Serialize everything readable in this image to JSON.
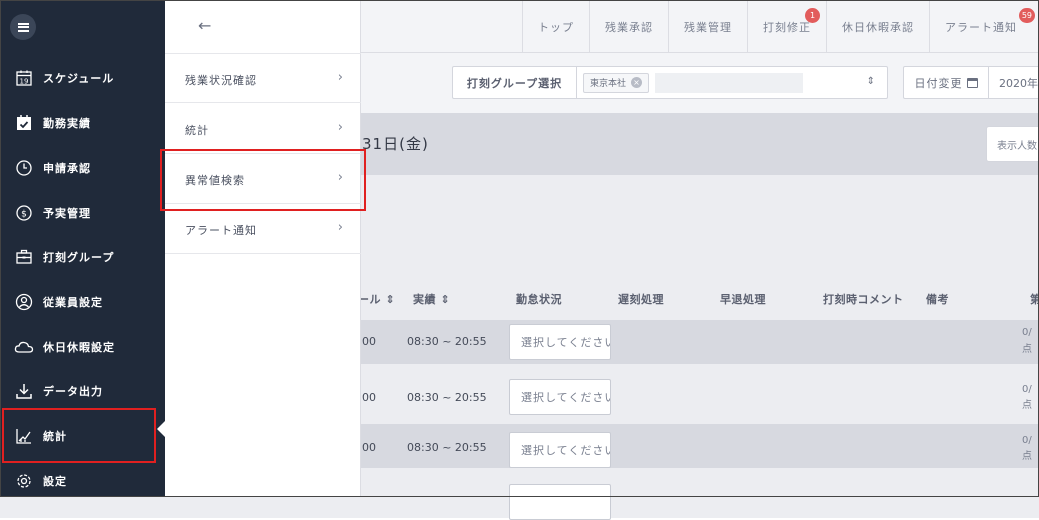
{
  "topnav": [
    {
      "label": "トップ",
      "badge": ""
    },
    {
      "label": "残業承認",
      "badge": ""
    },
    {
      "label": "残業管理",
      "badge": ""
    },
    {
      "label": "打刻修正",
      "badge": "1"
    },
    {
      "label": "休日休暇承認",
      "badge": ""
    },
    {
      "label": "アラート通知",
      "badge": "59"
    }
  ],
  "filter": {
    "group_label": "打刻グループ選択",
    "group_chip": "東京本社",
    "chip_clear_glyph": "×",
    "updown_glyph": "⇕",
    "date_change_label": "日付変更",
    "date_value": "2020年"
  },
  "date_title": "31日(金)",
  "show_count_label": "表示人数",
  "table": {
    "headers": [
      "ール ⇕",
      "実績 ⇕",
      "勤怠状況",
      "遅刻処理",
      "早退処理",
      "打刻時コメント",
      "備考",
      "第"
    ],
    "rows": [
      {
        "sched": "00",
        "actual": "08:30 ~ 20:55",
        "status": "選択してください",
        "edge1": "0/",
        "edge2": "点"
      },
      {
        "sched": "00",
        "actual": "08:30 ~ 20:55",
        "status": "選択してください",
        "edge1": "0/",
        "edge2": "点"
      },
      {
        "sched": "00",
        "actual": "08:30 ~ 20:55",
        "status": "選択してください",
        "edge1": "0/",
        "edge2": "点"
      },
      {
        "sched": "",
        "actual": "",
        "status": "",
        "edge1": "",
        "edge2": ""
      }
    ]
  },
  "sidebar": {
    "items": [
      {
        "label": "スケジュール",
        "icon": "calendar-icon"
      },
      {
        "label": "勤務実績",
        "icon": "calendar-check-icon"
      },
      {
        "label": "申請承認",
        "icon": "clock-icon"
      },
      {
        "label": "予実管理",
        "icon": "dollar-icon"
      },
      {
        "label": "打刻グループ",
        "icon": "briefcase-icon"
      },
      {
        "label": "従業員設定",
        "icon": "user-icon"
      },
      {
        "label": "休日休暇設定",
        "icon": "cloud-icon"
      },
      {
        "label": "データ出力",
        "icon": "download-icon"
      },
      {
        "label": "統計",
        "icon": "chart-icon"
      },
      {
        "label": "設定",
        "icon": "gear-icon"
      }
    ],
    "calendar_day": "19"
  },
  "submenu": {
    "back_glyph": "←",
    "chevron_glyph": "›",
    "items": [
      {
        "label": "残業状況確認"
      },
      {
        "label": "統計"
      },
      {
        "label": "異常値検索"
      },
      {
        "label": "アラート通知"
      }
    ]
  },
  "colors": {
    "sidebar_bg": "#202a3a",
    "highlight": "#e02020",
    "badge": "#e25c5c"
  }
}
